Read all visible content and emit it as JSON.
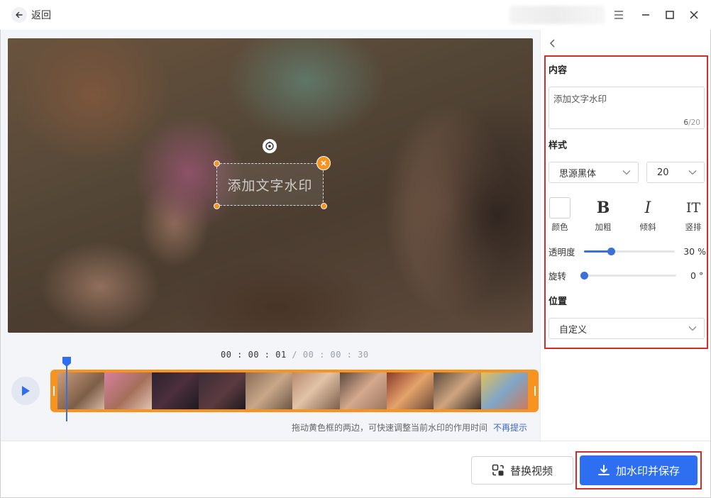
{
  "titlebar": {
    "back_label": "返回",
    "icons": [
      "arrow-left-icon",
      "menu-icon",
      "minimize-icon",
      "maximize-icon",
      "close-icon"
    ]
  },
  "preview": {
    "watermark_text": "添加文字水印"
  },
  "timeline": {
    "current_time": "00 : 00 : 01",
    "separator": " / ",
    "total_time": "00 : 00 : 30",
    "hint": "拖动黄色框的两边，可快速调整当前水印的作用时间",
    "dismiss_link": "不再提示"
  },
  "panel": {
    "content_title": "内容",
    "content_value": "添加文字水印",
    "content_count": "6",
    "content_max": "/20",
    "style_title": "样式",
    "font_family": "思源黑体",
    "font_size": "20",
    "tools": {
      "color": "颜色",
      "bold": "加粗",
      "italic": "倾斜",
      "vertical": "竖排",
      "bold_glyph": "B",
      "italic_glyph": "I",
      "vertical_glyph": "IT"
    },
    "opacity_label": "透明度",
    "opacity_value": "30",
    "opacity_unit": "%",
    "opacity_fraction": 0.3,
    "rotation_label": "旋转",
    "rotation_value": "0",
    "rotation_unit": "°",
    "rotation_fraction": 0.0,
    "position_title": "位置",
    "position_value": "自定义"
  },
  "actions": {
    "replace_label": "替换视频",
    "save_label": "加水印并保存"
  },
  "colors": {
    "accent": "#2d6ff0",
    "timeline": "#f7931e",
    "highlight": "#d62b2b"
  }
}
